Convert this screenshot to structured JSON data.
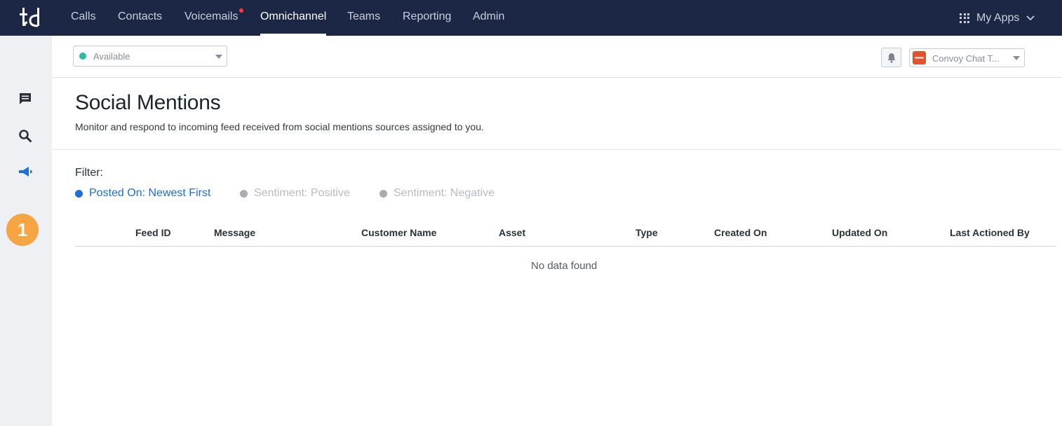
{
  "topnav": {
    "logo_text": "td",
    "items": [
      {
        "label": "Calls"
      },
      {
        "label": "Contacts"
      },
      {
        "label": "Voicemails",
        "notification": true
      },
      {
        "label": "Omnichannel",
        "active": true
      },
      {
        "label": "Teams"
      },
      {
        "label": "Reporting"
      },
      {
        "label": "Admin"
      }
    ],
    "my_apps_label": "My Apps"
  },
  "sidebar": {
    "icons": [
      "chat-icon",
      "search-icon",
      "megaphone-icon"
    ],
    "step_badge": "1"
  },
  "toolbar": {
    "status": {
      "value": "Available",
      "color": "#1fbf9f"
    },
    "chat_select": {
      "value": "Convoy Chat T..."
    }
  },
  "header": {
    "title": "Social Mentions",
    "description": "Monitor and respond to incoming feed received from social mentions sources assigned to you."
  },
  "filters": {
    "label": "Filter:",
    "options": [
      {
        "label": "Posted On: Newest First",
        "active": true
      },
      {
        "label": "Sentiment: Positive",
        "active": false
      },
      {
        "label": "Sentiment: Negative",
        "active": false
      }
    ]
  },
  "table": {
    "columns": [
      "Feed ID",
      "Message",
      "Customer Name",
      "Asset",
      "Type",
      "Created On",
      "Updated On",
      "Last Actioned By"
    ],
    "empty_text": "No data found"
  },
  "colors": {
    "nav_bg": "#1b2744",
    "accent": "#1b6fd8",
    "badge": "#f6a542"
  }
}
